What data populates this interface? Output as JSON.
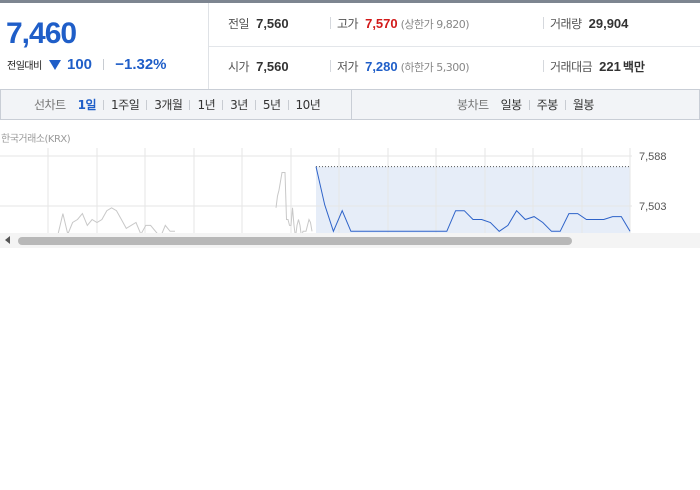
{
  "summary": {
    "price": "7,460",
    "change_label": "전일대비",
    "change_amount": "100",
    "change_percent": "−1.32%",
    "prev_close": {
      "label": "전일",
      "value": "7,560"
    },
    "high": {
      "label": "고가",
      "value": "7,570",
      "sub": "(상한가 9,820)"
    },
    "volume": {
      "label": "거래량",
      "value": "29,904"
    },
    "open": {
      "label": "시가",
      "value": "7,560"
    },
    "low": {
      "label": "저가",
      "value": "7,280",
      "sub": "(하한가 5,300)"
    },
    "trade_value": {
      "label": "거래대금",
      "value": "221",
      "unit": "백만"
    }
  },
  "tabs": {
    "line_label": "선차트",
    "line_tabs": [
      "1일",
      "1주일",
      "3개월",
      "1년",
      "3년",
      "5년",
      "10년"
    ],
    "active_line_tab": "1일",
    "candle_label": "봉차트",
    "candle_tabs": [
      "일봉",
      "주봉",
      "월봉"
    ]
  },
  "chart": {
    "market_label": "한국거래소(KRX)"
  },
  "chart_data": {
    "type": "line",
    "title": "",
    "y_ticks": [
      "7,588",
      "7,503"
    ],
    "ylim": [
      7420,
      7600
    ],
    "grid": true,
    "series": [
      {
        "values": [
          7455,
          7490,
          7455,
          7475,
          7480,
          7490,
          7470,
          7480,
          7475,
          7480,
          7495,
          7500,
          7495,
          7480,
          7465,
          7470,
          7475,
          7455,
          7470,
          7470,
          7460,
          7450,
          7470,
          7460,
          7460
        ]
      },
      {
        "values": [
          7500,
          7520,
          7530,
          7545,
          7560,
          7560,
          7560,
          7480,
          7480,
          7470,
          7470,
          7500,
          7470,
          7450,
          7470,
          7480,
          7470,
          7450,
          7460,
          7460,
          7460,
          7470,
          7480,
          7475,
          7460
        ]
      },
      {
        "values": [
          7570,
          7505,
          7460,
          7495,
          7460,
          7460,
          7460,
          7460,
          7460,
          7460,
          7460,
          7460,
          7460,
          7460,
          7460,
          7460,
          7495,
          7495,
          7480,
          7480,
          7475,
          7460,
          7470,
          7495,
          7480,
          7485,
          7475,
          7460,
          7460,
          7490,
          7490,
          7480,
          7480,
          7480,
          7485,
          7485,
          7460
        ]
      }
    ],
    "ref_line": 7570
  }
}
